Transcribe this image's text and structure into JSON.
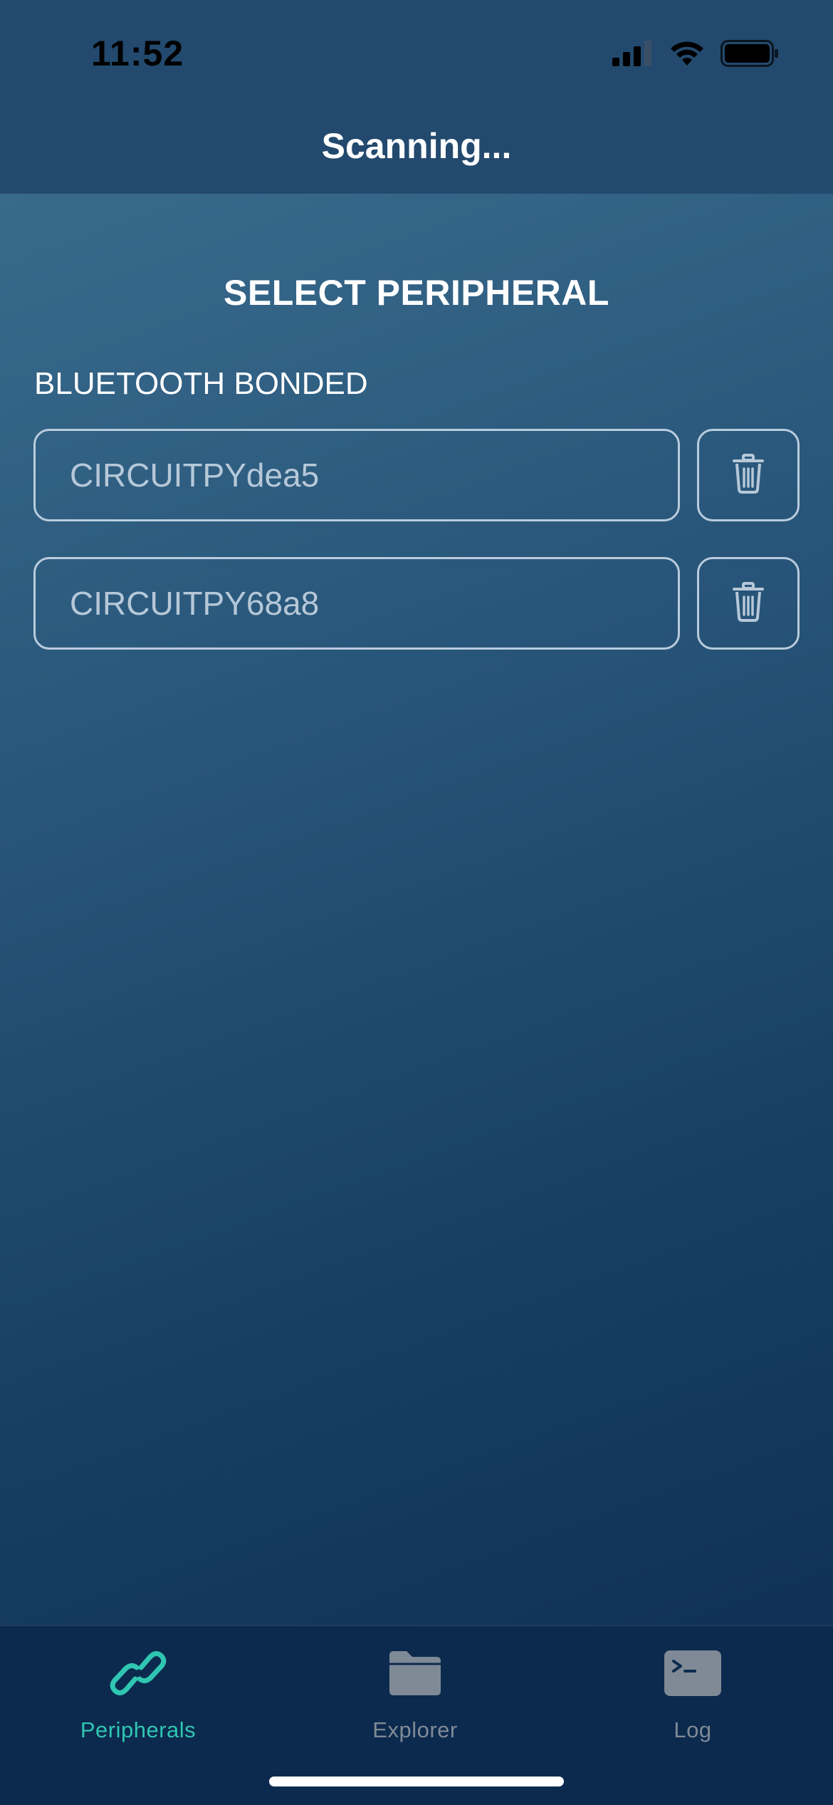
{
  "status_bar": {
    "time": "11:52"
  },
  "header": {
    "title": "Scanning..."
  },
  "main": {
    "section_title": "SELECT PERIPHERAL",
    "group_label": "BLUETOOTH BONDED",
    "peripherals": [
      {
        "name": "CIRCUITPYdea5"
      },
      {
        "name": "CIRCUITPY68a8"
      }
    ]
  },
  "tab_bar": {
    "tabs": [
      {
        "label": "Peripherals",
        "icon": "link-icon",
        "active": true
      },
      {
        "label": "Explorer",
        "icon": "folder-icon",
        "active": false
      },
      {
        "label": "Log",
        "icon": "terminal-icon",
        "active": false
      }
    ]
  },
  "colors": {
    "accent": "#2fc6b2",
    "inactive_tab": "#7f8a96",
    "header_bg": "#234a6e",
    "tab_bar_bg": "#0c2a4e"
  }
}
